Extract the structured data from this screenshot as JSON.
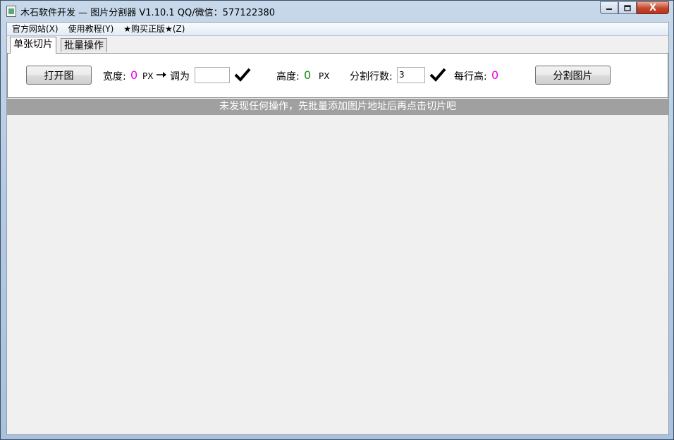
{
  "window": {
    "title": "木石软件开发 — 图片分割器 V1.10.1    QQ/微信：577122380",
    "buttons": {
      "minimize": "▭",
      "maximize": "▢",
      "close": "X"
    }
  },
  "menu": [
    {
      "label": "官方网站(X)"
    },
    {
      "label": "使用教程(Y)"
    },
    {
      "label": "★购买正版★(Z)"
    }
  ],
  "tabs": [
    {
      "label": "单张切片",
      "active": true
    },
    {
      "label": "批量操作",
      "active": false
    }
  ],
  "panel": {
    "open_button": "打开图",
    "width_label": "宽度:",
    "width_value": "0",
    "width_unit": "PX",
    "adjust_label": "调为",
    "adjust_value": "",
    "height_label": "高度:",
    "height_value": "0",
    "height_unit": "PX",
    "rows_label": "分割行数:",
    "rows_value": "3",
    "row_height_label": "每行高:",
    "row_height_value": "0",
    "split_button": "分割图片"
  },
  "status": {
    "message": "未发现任何操作，先批量添加图片地址后再点击切片吧"
  },
  "colors": {
    "value_pink": "#e600e6",
    "value_green": "#1a8a1a",
    "status_bg": "#a0a0a0"
  }
}
